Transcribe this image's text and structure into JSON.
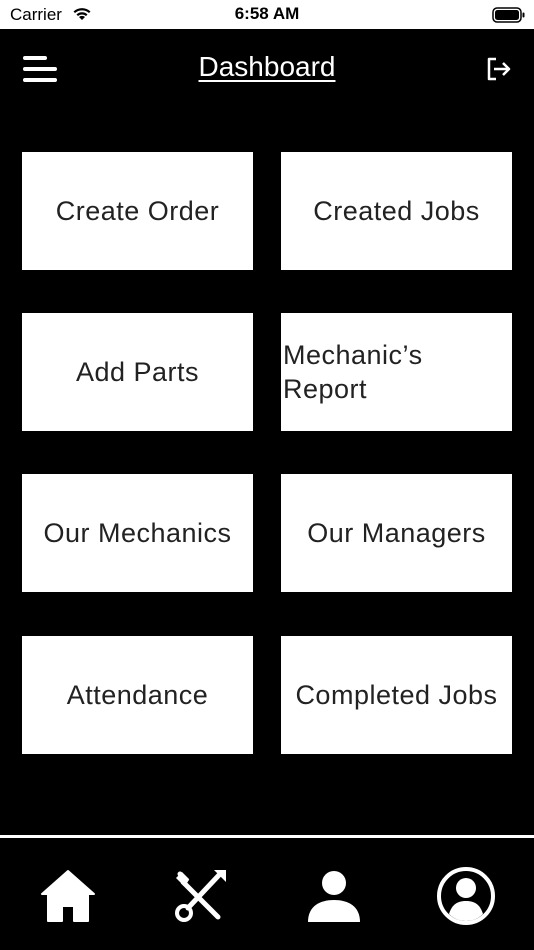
{
  "status_bar": {
    "carrier": "Carrier",
    "time": "6:58 AM",
    "icons": [
      "wifi-icon",
      "battery-icon"
    ]
  },
  "header": {
    "title": "Dashboard",
    "menu_icon": "hamburger-menu-icon",
    "logout_icon": "logout-icon"
  },
  "tiles": [
    {
      "label": "Create Order"
    },
    {
      "label": "Created Jobs"
    },
    {
      "label": "Add Parts"
    },
    {
      "label": "Mechanic’s Report"
    },
    {
      "label": "Our Mechanics"
    },
    {
      "label": "Our Managers"
    },
    {
      "label": "Attendance"
    },
    {
      "label": "Completed Jobs"
    }
  ],
  "tab_bar": {
    "tabs": [
      {
        "icon": "home-icon"
      },
      {
        "icon": "tools-icon"
      },
      {
        "icon": "person-icon"
      },
      {
        "icon": "account-circle-icon"
      }
    ]
  },
  "colors": {
    "background": "#000000",
    "tile": "#ffffff",
    "tile_text": "#222222",
    "header_text": "#ffffff"
  }
}
